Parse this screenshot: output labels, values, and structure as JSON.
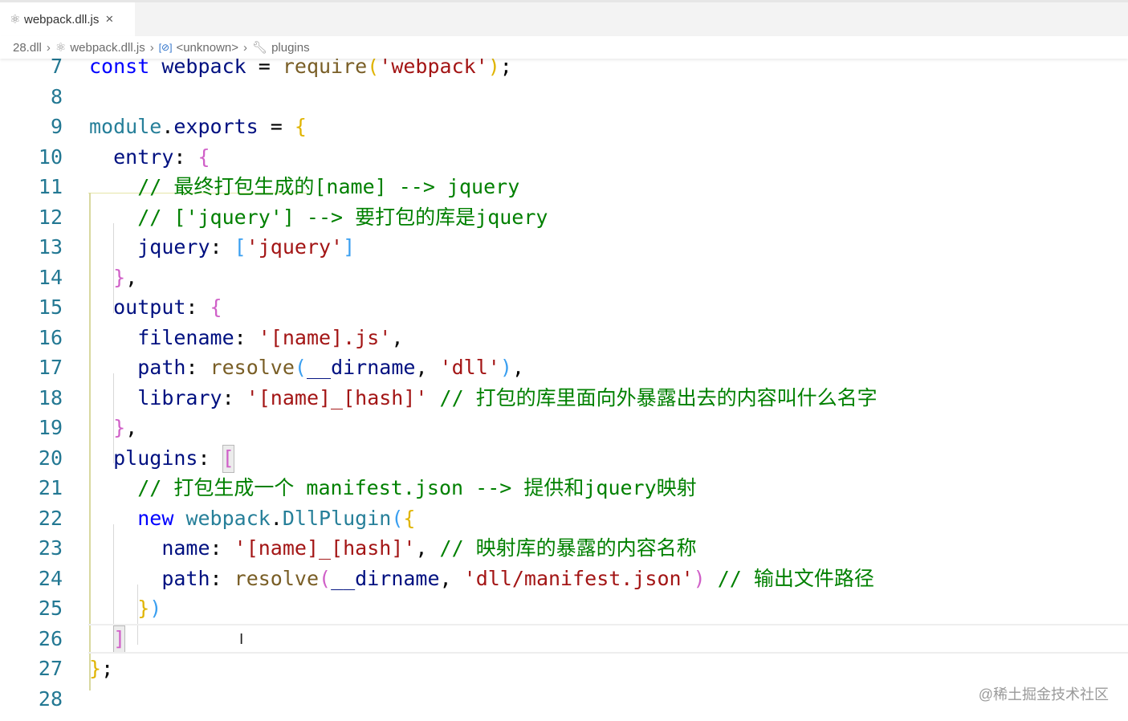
{
  "tab": {
    "icon": "react-icon",
    "title": "webpack.dll.js",
    "close": "×"
  },
  "breadcrumb": [
    "28.dll",
    "webpack.dll.js",
    "<unknown>",
    "plugins"
  ],
  "editor": {
    "current_line": 26,
    "lines": [
      {
        "num": "7",
        "tokens": [
          [
            "k",
            "const"
          ],
          [
            "p",
            " "
          ],
          [
            "v",
            "webpack"
          ],
          [
            "p",
            " = "
          ],
          [
            "f",
            "require"
          ],
          [
            "b1",
            "("
          ],
          [
            "s",
            "'webpack'"
          ],
          [
            "b1",
            ")"
          ],
          [
            "p",
            ";"
          ]
        ]
      },
      {
        "num": "8",
        "tokens": []
      },
      {
        "num": "9",
        "tokens": [
          [
            "t",
            "module"
          ],
          [
            "p",
            "."
          ],
          [
            "v",
            "exports"
          ],
          [
            "p",
            " = "
          ],
          [
            "b1",
            "{"
          ]
        ]
      },
      {
        "num": "10",
        "tokens": [
          [
            "p",
            "  "
          ],
          [
            "v",
            "entry"
          ],
          [
            "p",
            ": "
          ],
          [
            "b2",
            "{"
          ]
        ]
      },
      {
        "num": "11",
        "tokens": [
          [
            "p",
            "    "
          ],
          [
            "c",
            "// 最终打包生成的[name] --> jquery"
          ]
        ]
      },
      {
        "num": "12",
        "tokens": [
          [
            "p",
            "    "
          ],
          [
            "c",
            "// ['jquery'] --> 要打包的库是jquery"
          ]
        ]
      },
      {
        "num": "13",
        "tokens": [
          [
            "p",
            "    "
          ],
          [
            "v",
            "jquery"
          ],
          [
            "p",
            ": "
          ],
          [
            "b3",
            "["
          ],
          [
            "s",
            "'jquery'"
          ],
          [
            "b3",
            "]"
          ]
        ]
      },
      {
        "num": "14",
        "tokens": [
          [
            "p",
            "  "
          ],
          [
            "b2",
            "}"
          ],
          [
            "p",
            ","
          ]
        ]
      },
      {
        "num": "15",
        "tokens": [
          [
            "p",
            "  "
          ],
          [
            "v",
            "output"
          ],
          [
            "p",
            ": "
          ],
          [
            "b2",
            "{"
          ]
        ]
      },
      {
        "num": "16",
        "tokens": [
          [
            "p",
            "    "
          ],
          [
            "v",
            "filename"
          ],
          [
            "p",
            ": "
          ],
          [
            "s",
            "'[name].js'"
          ],
          [
            "p",
            ","
          ]
        ]
      },
      {
        "num": "17",
        "tokens": [
          [
            "p",
            "    "
          ],
          [
            "v",
            "path"
          ],
          [
            "p",
            ": "
          ],
          [
            "f",
            "resolve"
          ],
          [
            "b3",
            "("
          ],
          [
            "v",
            "__dirname"
          ],
          [
            "p",
            ", "
          ],
          [
            "s",
            "'dll'"
          ],
          [
            "b3",
            ")"
          ],
          [
            "p",
            ","
          ]
        ]
      },
      {
        "num": "18",
        "tokens": [
          [
            "p",
            "    "
          ],
          [
            "v",
            "library"
          ],
          [
            "p",
            ": "
          ],
          [
            "s",
            "'[name]_[hash]'"
          ],
          [
            "p",
            " "
          ],
          [
            "c",
            "// 打包的库里面向外暴露出去的内容叫什么名字"
          ]
        ]
      },
      {
        "num": "19",
        "tokens": [
          [
            "p",
            "  "
          ],
          [
            "b2",
            "}"
          ],
          [
            "p",
            ","
          ]
        ]
      },
      {
        "num": "20",
        "tokens": [
          [
            "p",
            "  "
          ],
          [
            "v",
            "plugins"
          ],
          [
            "p",
            ": "
          ],
          [
            "b2",
            "["
          ]
        ]
      },
      {
        "num": "21",
        "tokens": [
          [
            "p",
            "    "
          ],
          [
            "c",
            "// 打包生成一个 manifest.json --> 提供和jquery映射"
          ]
        ]
      },
      {
        "num": "22",
        "tokens": [
          [
            "p",
            "    "
          ],
          [
            "k",
            "new"
          ],
          [
            "p",
            " "
          ],
          [
            "t",
            "webpack"
          ],
          [
            "p",
            "."
          ],
          [
            "t",
            "DllPlugin"
          ],
          [
            "b3",
            "("
          ],
          [
            "b1",
            "{"
          ]
        ]
      },
      {
        "num": "23",
        "tokens": [
          [
            "p",
            "      "
          ],
          [
            "v",
            "name"
          ],
          [
            "p",
            ": "
          ],
          [
            "s",
            "'[name]_[hash]'"
          ],
          [
            "p",
            ", "
          ],
          [
            "c",
            "// 映射库的暴露的内容名称"
          ]
        ]
      },
      {
        "num": "24",
        "tokens": [
          [
            "p",
            "      "
          ],
          [
            "v",
            "path"
          ],
          [
            "p",
            ": "
          ],
          [
            "f",
            "resolve"
          ],
          [
            "b2",
            "("
          ],
          [
            "v",
            "__dirname"
          ],
          [
            "p",
            ", "
          ],
          [
            "s",
            "'dll/manifest.json'"
          ],
          [
            "b2",
            ")"
          ],
          [
            "p",
            " "
          ],
          [
            "c",
            "// 输出文件路径"
          ]
        ]
      },
      {
        "num": "25",
        "tokens": [
          [
            "p",
            "    "
          ],
          [
            "b1",
            "}"
          ],
          [
            "b3",
            ")"
          ]
        ]
      },
      {
        "num": "26",
        "tokens": [
          [
            "p",
            "  "
          ],
          [
            "b2",
            "]"
          ]
        ]
      },
      {
        "num": "27",
        "tokens": [
          [
            "b1",
            "}"
          ],
          [
            "p",
            ";"
          ]
        ]
      },
      {
        "num": "28",
        "tokens": []
      }
    ]
  },
  "watermark": "@稀土掘金技术社区"
}
